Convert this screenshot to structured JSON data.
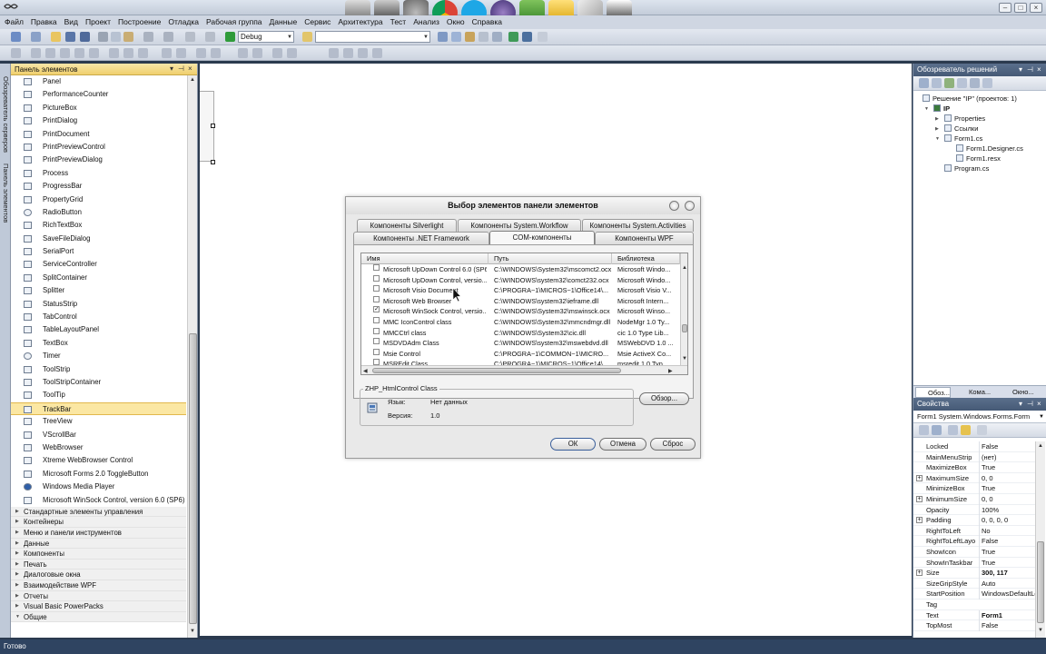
{
  "menu": [
    "Файл",
    "Правка",
    "Вид",
    "Проект",
    "Построение",
    "Отладка",
    "Рабочая группа",
    "Данные",
    "Сервис",
    "Архитектура",
    "Тест",
    "Анализ",
    "Окно",
    "Справка"
  ],
  "toolbar": {
    "config": "Debug",
    "search_value": ""
  },
  "toolbox": {
    "title": "Панель элементов",
    "vertical_tabs": [
      "Обозреватель серверов",
      "Панель элементов"
    ],
    "items": [
      "Panel",
      "PerformanceCounter",
      "PictureBox",
      "PrintDialog",
      "PrintDocument",
      "PrintPreviewControl",
      "PrintPreviewDialog",
      "Process",
      "ProgressBar",
      "PropertyGrid",
      "RadioButton",
      "RichTextBox",
      "SaveFileDialog",
      "SerialPort",
      "ServiceController",
      "SplitContainer",
      "Splitter",
      "StatusStrip",
      "TabControl",
      "TableLayoutPanel",
      "TextBox",
      "Timer",
      "ToolStrip",
      "ToolStripContainer",
      "ToolTip",
      "TrackBar",
      "TreeView",
      "VScrollBar",
      "WebBrowser",
      "Xtreme WebBrowser Control",
      "Microsoft Forms 2.0 ToggleButton",
      "Windows Media Player",
      "Microsoft WinSock Control, version 6.0 (SP6)"
    ],
    "selected_item": "TrackBar",
    "categories": [
      "Стандартные элементы управления",
      "Контейнеры",
      "Меню и панели инструментов",
      "Данные",
      "Компоненты",
      "Печать",
      "Диалоговые окна",
      "Взаимодействие WPF",
      "Отчеты",
      "Visual Basic PowerPacks",
      "Общие"
    ]
  },
  "dialog": {
    "title": "Выбор элементов панели элементов",
    "tabs_row1": [
      "Компоненты Silverlight",
      "Компоненты System.Workflow",
      "Компоненты System.Activities"
    ],
    "tabs_row2": [
      "Компоненты .NET Framework",
      "COM-компоненты",
      "Компоненты WPF"
    ],
    "active_tab": "COM-компоненты",
    "columns": [
      "Имя",
      "Путь",
      "Библиотека"
    ],
    "rows": [
      {
        "name": "Microsoft UpDown Control 6.0 (SP6)",
        "path": "C:\\WINDOWS\\System32\\mscomct2.ocx",
        "lib": "Microsoft Windo...",
        "checked": false
      },
      {
        "name": "Microsoft UpDown Control, versio...",
        "path": "C:\\WINDOWS\\system32\\comct232.ocx",
        "lib": "Microsoft Windo...",
        "checked": false
      },
      {
        "name": "Microsoft Visio Document",
        "path": "C:\\PROGRA~1\\MICROS~1\\Office14\\...",
        "lib": "Microsoft Visio V...",
        "checked": false
      },
      {
        "name": "Microsoft Web Browser",
        "path": "C:\\WINDOWS\\system32\\ieframe.dll",
        "lib": "Microsoft Intern...",
        "checked": false
      },
      {
        "name": "Microsoft WinSock Control, versio...",
        "path": "C:\\WINDOWS\\System32\\mswinsck.ocx",
        "lib": "Microsoft Winso...",
        "checked": true
      },
      {
        "name": "MMC IconControl class",
        "path": "C:\\WINDOWS\\System32\\mmcndmgr.dll",
        "lib": "NodeMgr 1.0 Ty...",
        "checked": false
      },
      {
        "name": "MMCCtrl class",
        "path": "C:\\WINDOWS\\System32\\cic.dll",
        "lib": "cic 1.0 Type Lib...",
        "checked": false
      },
      {
        "name": "MSDVDAdm Class",
        "path": "C:\\WINDOWS\\system32\\mswebdvd.dll",
        "lib": "MSWebDVD 1.0 ...",
        "checked": false
      },
      {
        "name": "Msie Control",
        "path": "C:\\PROGRA~1\\COMMON~1\\MICRO...",
        "lib": "Msie ActiveX Co...",
        "checked": false
      },
      {
        "name": "MSREdit Class",
        "path": "C:\\PROGRA~1\\MICROS~1\\Office14\\...",
        "lib": "msredit 1.0 Typ...",
        "checked": false
      }
    ],
    "info": {
      "group_title": "ZHP_HtmlControl Class",
      "lang_label": "Язык:",
      "lang_value": "Нет данных",
      "version_label": "Версия:",
      "version_value": "1.0"
    },
    "buttons": {
      "browse": "Обзор...",
      "ok": "ОК",
      "cancel": "Отмена",
      "reset": "Сброс"
    }
  },
  "solution": {
    "title": "Обозреватель решений",
    "tree": [
      "Решение \"IP\"  (проектов: 1)",
      "IP",
      "Properties",
      "Ссылки",
      "Form1.cs",
      "Form1.Designer.cs",
      "Form1.resx",
      "Program.cs"
    ],
    "tabs": [
      "Обоз...",
      "Кома...",
      "Окно..."
    ]
  },
  "properties": {
    "title": "Свойства",
    "object": "Form1  System.Windows.Forms.Form",
    "rows": [
      {
        "name": "Locked",
        "value": "False",
        "expandable": false,
        "bold": false
      },
      {
        "name": "MainMenuStrip",
        "value": "(нет)",
        "expandable": false,
        "bold": false
      },
      {
        "name": "MaximizeBox",
        "value": "True",
        "expandable": false,
        "bold": false
      },
      {
        "name": "MaximumSize",
        "value": "0, 0",
        "expandable": true,
        "bold": false
      },
      {
        "name": "MinimizeBox",
        "value": "True",
        "expandable": false,
        "bold": false
      },
      {
        "name": "MinimumSize",
        "value": "0, 0",
        "expandable": true,
        "bold": false
      },
      {
        "name": "Opacity",
        "value": "100%",
        "expandable": false,
        "bold": false
      },
      {
        "name": "Padding",
        "value": "0, 0, 0, 0",
        "expandable": true,
        "bold": false
      },
      {
        "name": "RightToLeft",
        "value": "No",
        "expandable": false,
        "bold": false
      },
      {
        "name": "RightToLeftLayo",
        "value": "False",
        "expandable": false,
        "bold": false
      },
      {
        "name": "ShowIcon",
        "value": "True",
        "expandable": false,
        "bold": false
      },
      {
        "name": "ShowInTaskbar",
        "value": "True",
        "expandable": false,
        "bold": false
      },
      {
        "name": "Size",
        "value": "300, 117",
        "expandable": true,
        "bold": true
      },
      {
        "name": "SizeGripStyle",
        "value": "Auto",
        "expandable": false,
        "bold": false
      },
      {
        "name": "StartPosition",
        "value": "WindowsDefaultLo",
        "expandable": false,
        "bold": false
      },
      {
        "name": "Tag",
        "value": "",
        "expandable": false,
        "bold": false
      },
      {
        "name": "Text",
        "value": "Form1",
        "expandable": false,
        "bold": true
      },
      {
        "name": "TopMost",
        "value": "False",
        "expandable": false,
        "bold": false
      }
    ]
  },
  "status": "Готово",
  "colors": {
    "selection": "#fbe7a3",
    "panel_header": "#465a76",
    "statusbar": "#2f4461"
  }
}
